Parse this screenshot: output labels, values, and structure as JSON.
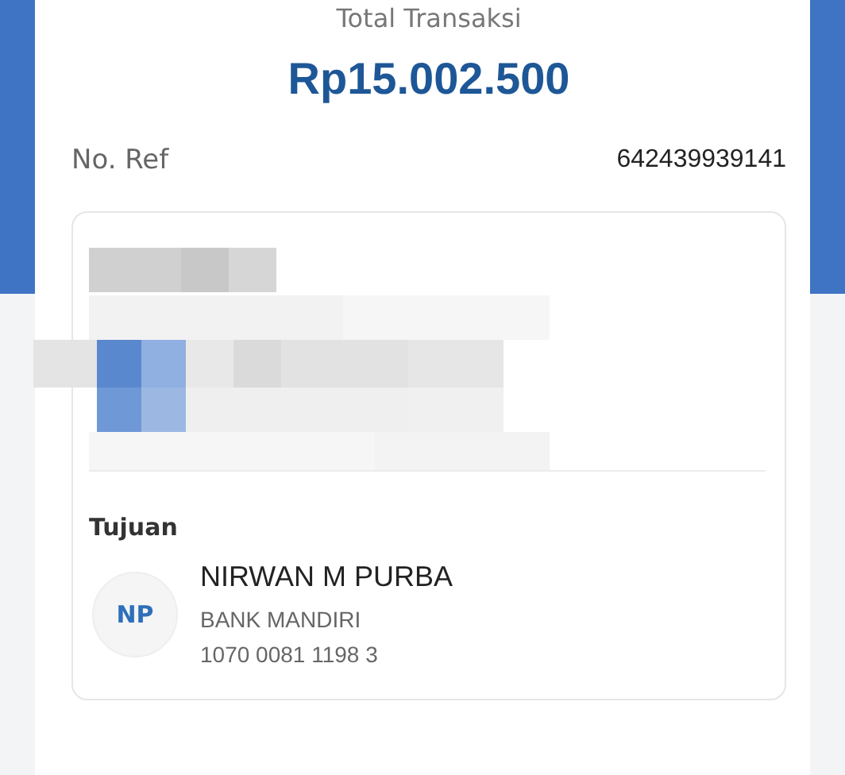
{
  "summary": {
    "label": "Total Transaksi",
    "amount": "Rp15.002.500"
  },
  "reference": {
    "label": "No. Ref",
    "value": "642439939141"
  },
  "details": {
    "hidden": true
  },
  "recipient": {
    "heading": "Tujuan",
    "initials": "NP",
    "name": "NIRWAN M PURBA",
    "bank": "BANK MANDIRI",
    "account": "1070 0081 1198 3"
  }
}
